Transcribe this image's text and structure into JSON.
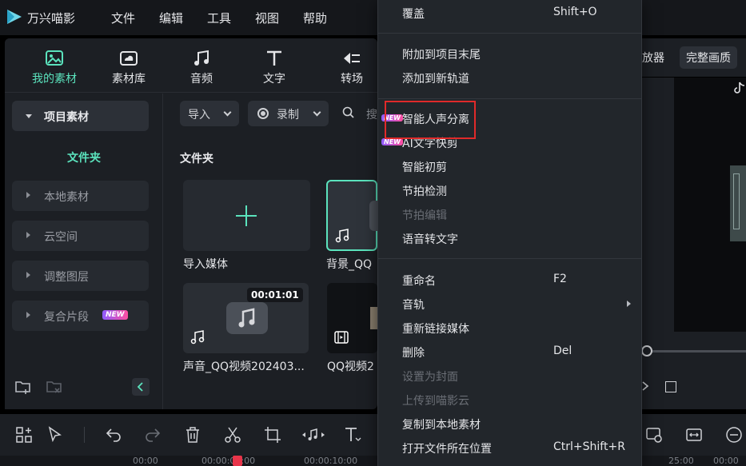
{
  "app": {
    "name": "万兴喵影"
  },
  "menubar": [
    "文件",
    "编辑",
    "工具",
    "视图",
    "帮助"
  ],
  "asset_tabs": [
    {
      "label": "我的素材",
      "icon": "my-media-icon",
      "active": true
    },
    {
      "label": "素材库",
      "icon": "cloud-library-icon",
      "active": false
    },
    {
      "label": "音频",
      "icon": "music-note-icon",
      "active": false
    },
    {
      "label": "文字",
      "icon": "text-t-icon",
      "active": false
    },
    {
      "label": "转场",
      "icon": "transition-icon",
      "active": false
    }
  ],
  "sidebar": {
    "project_media": "项目素材",
    "folder": "文件夹",
    "items": [
      "本地素材",
      "云空间",
      "调整图层",
      "复合片段"
    ],
    "new_badge": "NEW"
  },
  "media_toolbar": {
    "import_label": "导入",
    "record_label": "录制",
    "search_placeholder": "搜"
  },
  "media": {
    "header": "文件夹",
    "cards": [
      {
        "label": "导入媒体"
      },
      {
        "label": "背景_QQ"
      },
      {
        "label": "声音_QQ视频202403...",
        "duration": "00:01:01"
      },
      {
        "label": "QQ视频2"
      }
    ]
  },
  "right_panel": {
    "btn1": "放器",
    "btn2": "完整画质"
  },
  "context_menu": {
    "items": [
      {
        "label": "覆盖",
        "shortcut": "Shift+O"
      },
      {
        "label": "附加到项目末尾"
      },
      {
        "label": "添加到新轨道"
      },
      {
        "label": "智能人声分离",
        "new": "NEW"
      },
      {
        "label": "AI文字快剪",
        "new": "NEW"
      },
      {
        "label": "智能初剪"
      },
      {
        "label": "节拍检测"
      },
      {
        "label": "节拍编辑",
        "disabled": true
      },
      {
        "label": "语音转文字"
      },
      {
        "label": "重命名",
        "shortcut": "F2"
      },
      {
        "label": "音轨",
        "submenu": true
      },
      {
        "label": "重新链接媒体"
      },
      {
        "label": "删除",
        "shortcut": "Del"
      },
      {
        "label": "设置为封面",
        "disabled": true
      },
      {
        "label": "上传到喵影云",
        "disabled": true
      },
      {
        "label": "复制到本地素材"
      },
      {
        "label": "打开文件所在位置",
        "shortcut": "Ctrl+Shift+R"
      }
    ]
  },
  "ruler": {
    "t1": "00:00",
    "t2": "00:00:05:00",
    "t3": "00:00:10:00",
    "t4": "25:00",
    "t5": "00:00"
  },
  "colors": {
    "accent": "#5be3bd",
    "highlight": "#e02a2a",
    "badge": "#ff4fa0"
  }
}
